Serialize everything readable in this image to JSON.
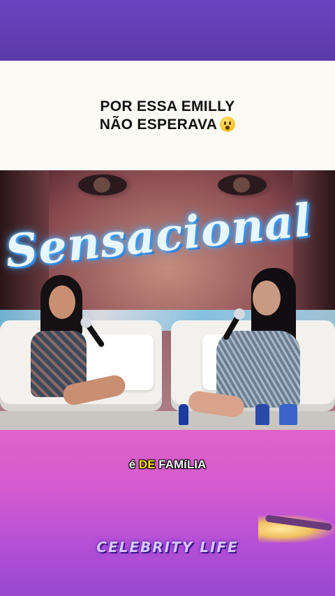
{
  "header": {
    "caption_line1": "POR ESSA EMILLY",
    "caption_line2": "NÃO ESPERAVA",
    "caption_emoji": "surprised-face-emoji"
  },
  "video": {
    "backdrop_text": "Sensacional"
  },
  "subtitle": {
    "word1": "é",
    "word2": "DE",
    "word3": "FAMíLIA",
    "highlight_color": "#ffe600"
  },
  "watermark": {
    "text": "CELEBRITY LIFE"
  },
  "colors": {
    "top_band": "#6a44c2",
    "caption_bg": "#fbfaf4",
    "bottom_gradient_top": "#e063c9",
    "bottom_gradient_bottom": "#9748cf"
  }
}
